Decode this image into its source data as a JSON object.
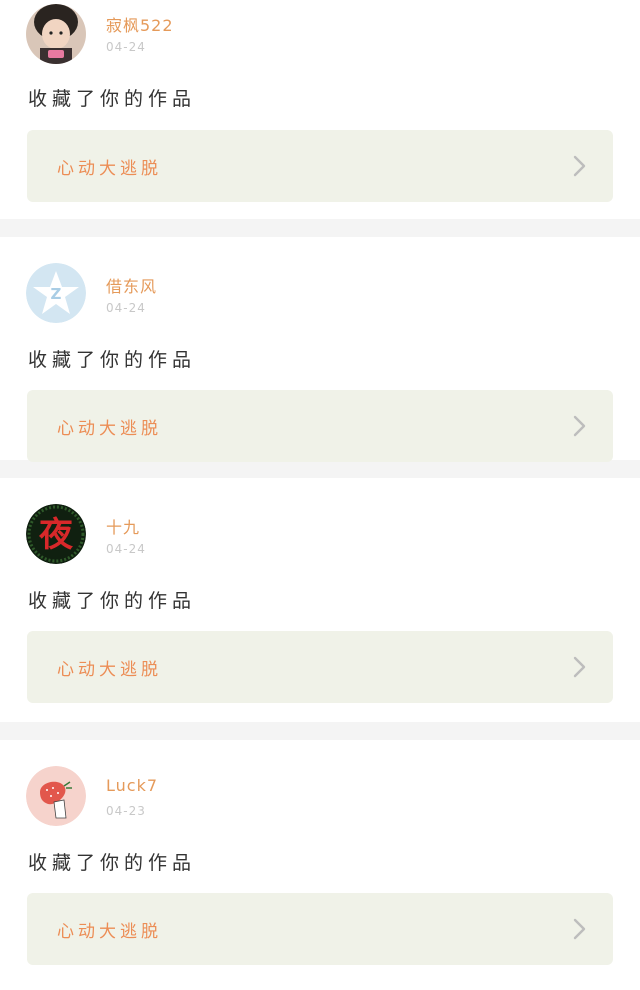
{
  "feed": {
    "items": [
      {
        "username": "寂枫522",
        "date": "04-24",
        "action": "收藏了你的作品",
        "work_title": "心动大逃脱",
        "avatar": "child-photo-avatar"
      },
      {
        "username": "借东风",
        "date": "04-24",
        "action": "收藏了你的作品",
        "work_title": "心动大逃脱",
        "avatar": "qzone-star-avatar"
      },
      {
        "username": "十九",
        "date": "04-24",
        "action": "收藏了你的作品",
        "work_title": "心动大逃脱",
        "avatar": "night-character-avatar"
      },
      {
        "username": "Luck7",
        "date": "04-23",
        "action": "收藏了你的作品",
        "work_title": "心动大逃脱",
        "avatar": "strawberry-cartoon-avatar"
      }
    ]
  },
  "colors": {
    "username": "#e59a5a",
    "work_title": "#ec8d55",
    "card_link_bg": "#f0f2e8",
    "date": "#c8c8c8",
    "separator": "#f4f4f4"
  },
  "icons": {
    "chevron": "chevron-right-icon"
  }
}
